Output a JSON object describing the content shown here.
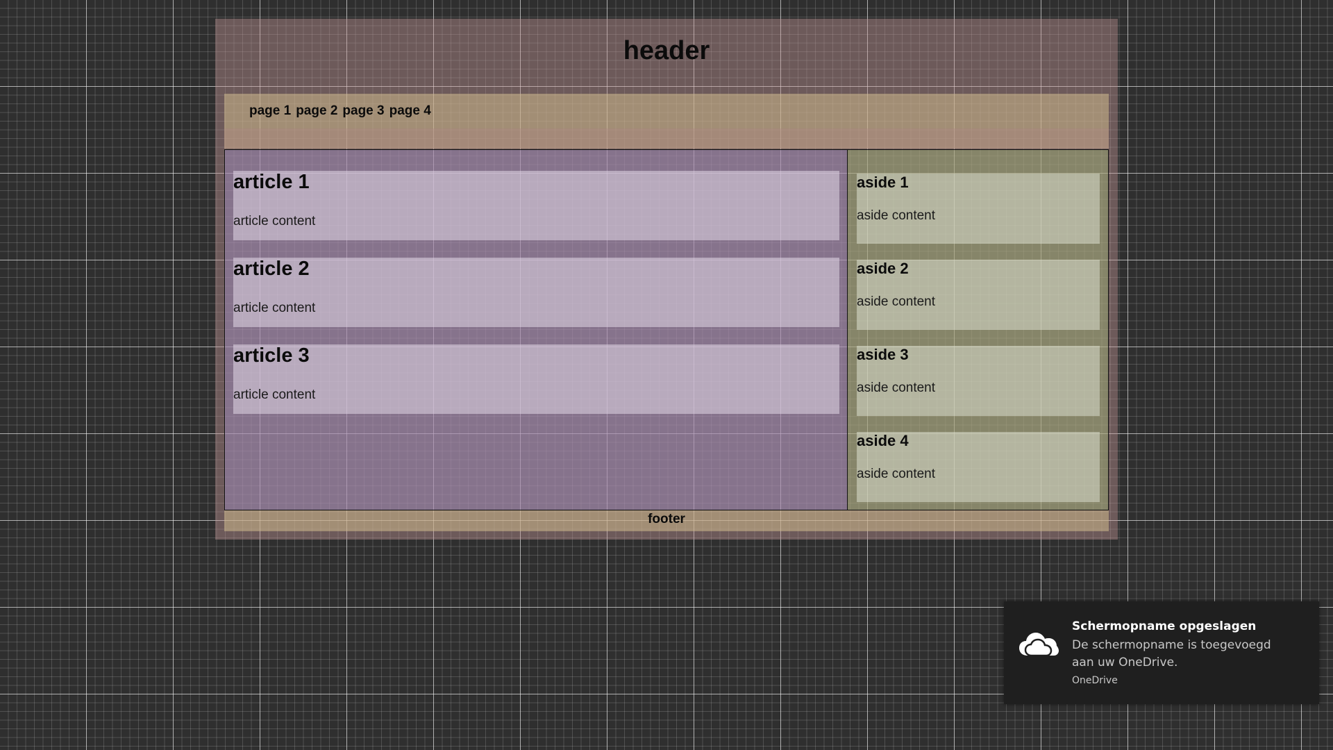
{
  "page": {
    "header_title": "header",
    "nav": [
      "page 1",
      "page 2",
      "page 3",
      "page 4"
    ],
    "articles": [
      {
        "title": "article 1",
        "content": "article content"
      },
      {
        "title": "article 2",
        "content": "article content"
      },
      {
        "title": "article 3",
        "content": "article content"
      }
    ],
    "asides": [
      {
        "title": "aside 1",
        "content": "aside content"
      },
      {
        "title": "aside 2",
        "content": "aside content"
      },
      {
        "title": "aside 3",
        "content": "aside content"
      },
      {
        "title": "aside 4",
        "content": "aside content"
      }
    ],
    "footer": "footer"
  },
  "toast": {
    "icon": "onedrive-cloud-icon",
    "title": "Schermopname opgeslagen",
    "body": "De schermopname is toegevoegd aan uw OneDrive.",
    "source": "OneDrive"
  },
  "colors": {
    "background": "#2f2f2f",
    "toast_background": "#1f1f1f"
  }
}
